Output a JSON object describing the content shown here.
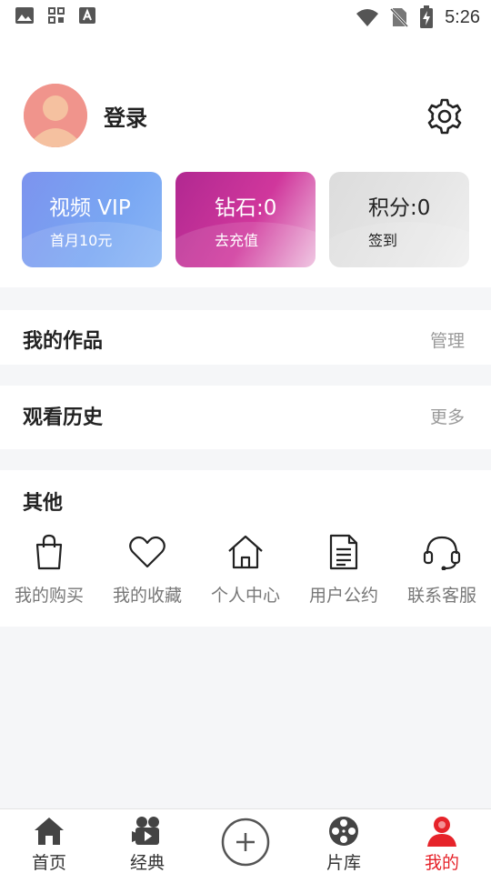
{
  "status_bar": {
    "time": "5:26"
  },
  "profile": {
    "login_label": "登录"
  },
  "cards": {
    "vip": {
      "title": "视频 VIP",
      "subtitle": "首月10元"
    },
    "diamond": {
      "title": "钻石:0",
      "subtitle": "去充值"
    },
    "points": {
      "title": "积分:0",
      "subtitle": "签到"
    }
  },
  "sections": {
    "works": {
      "title": "我的作品",
      "action": "管理"
    },
    "history": {
      "title": "观看历史",
      "action": "更多"
    },
    "others": {
      "title": "其他",
      "items": [
        {
          "label": "我的购买",
          "icon": "shopping-bag-icon"
        },
        {
          "label": "我的收藏",
          "icon": "heart-icon"
        },
        {
          "label": "个人中心",
          "icon": "home-icon"
        },
        {
          "label": "用户公约",
          "icon": "document-icon"
        },
        {
          "label": "联系客服",
          "icon": "headset-icon"
        }
      ]
    }
  },
  "tabbar": {
    "items": [
      {
        "label": "首页",
        "icon": "home-icon"
      },
      {
        "label": "经典",
        "icon": "video-camera-icon"
      },
      {
        "label": "",
        "icon": "add-circle-icon"
      },
      {
        "label": "片库",
        "icon": "film-reel-icon"
      },
      {
        "label": "我的",
        "icon": "user-icon",
        "active": true
      }
    ],
    "active_color": "#e6232a"
  },
  "colors": {
    "vip_gradient": [
      "#7c93ee",
      "#8ab6f5"
    ],
    "diamond_gradient": [
      "#b12891",
      "#eec0df"
    ],
    "points_gradient": [
      "#dcdcdc",
      "#efefef"
    ],
    "avatar": "#f0948c"
  }
}
